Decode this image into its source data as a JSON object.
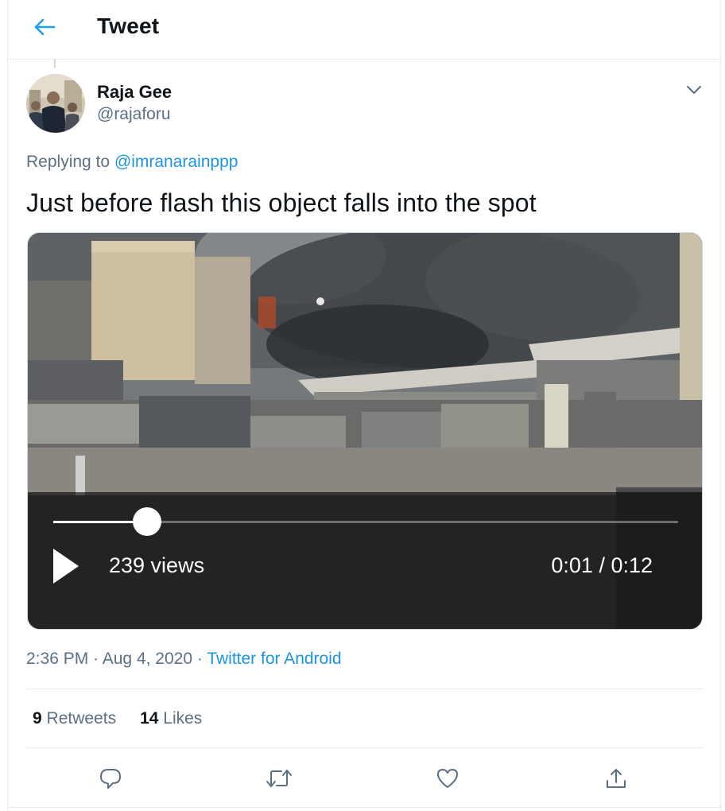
{
  "header": {
    "title": "Tweet",
    "back_icon": "arrow-left-icon"
  },
  "tweet": {
    "author": {
      "display_name": "Raja Gee",
      "handle": "@rajaforu"
    },
    "replying_prefix": "Replying to",
    "replying_to": "@imranarainppp",
    "text": "Just before flash this object falls into the spot",
    "video": {
      "views": "239 views",
      "time": "0:01 / 0:12",
      "progress": 0.15
    },
    "time": "2:36 PM",
    "separator": "·",
    "date": "Aug 4, 2020",
    "source": "Twitter for Android",
    "stats": {
      "retweets_count": "9",
      "retweets_label": "Retweets",
      "likes_count": "14",
      "likes_label": "Likes"
    }
  },
  "actions": [
    "reply-icon",
    "retweet-icon",
    "like-icon",
    "share-icon"
  ],
  "colors": {
    "accent": "#1b95e0",
    "secondary_text": "#5b7083",
    "border": "#e6ecf0"
  }
}
